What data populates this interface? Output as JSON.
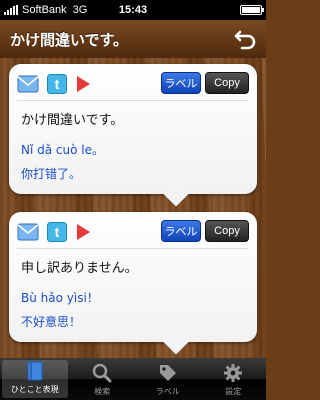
{
  "status": {
    "carrier": "SoftBank",
    "network": "3G",
    "time": "15:43"
  },
  "nav": {
    "title": "かけ間違いです。"
  },
  "cards": [
    {
      "phrase_jp": "かけ間違いです。",
      "pinyin": "Nǐ dǎ cuò le。",
      "chinese": "你打错了。",
      "label_btn": "ラベル",
      "copy_btn": "Copy"
    },
    {
      "phrase_jp": "申し訳ありません。",
      "pinyin": "Bù hǎo yìsi！",
      "chinese": "不好意思！",
      "label_btn": "ラベル",
      "copy_btn": "Copy"
    }
  ],
  "tabs": [
    {
      "label": "ひとこと表現",
      "icon": "book-icon",
      "active": true
    },
    {
      "label": "検索",
      "icon": "search-icon",
      "active": false
    },
    {
      "label": "ラベル",
      "icon": "tag-icon",
      "active": false
    },
    {
      "label": "設定",
      "icon": "gear-icon",
      "active": false
    }
  ],
  "colors": {
    "accent_blue": "#1a4dcc",
    "label_button": "#1043b8",
    "wood": "#6b3e18"
  }
}
